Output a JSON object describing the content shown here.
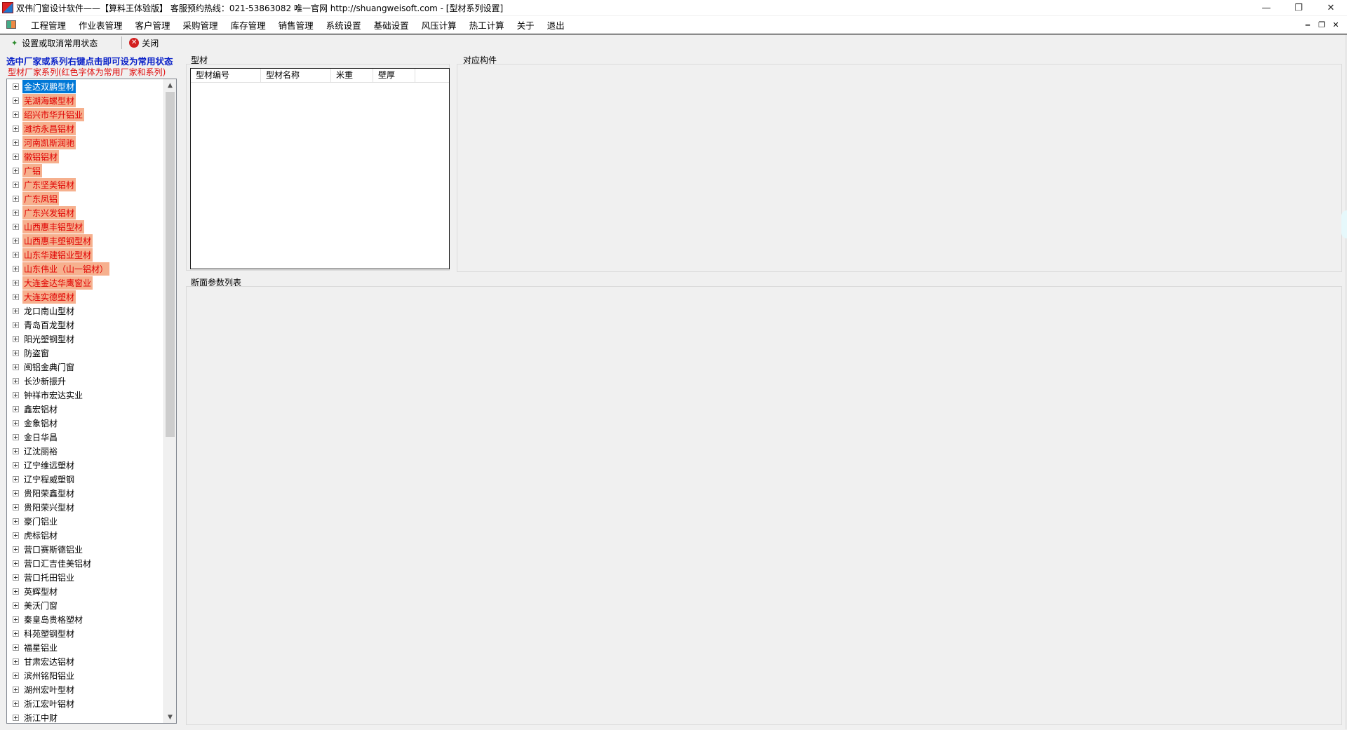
{
  "window": {
    "title": "双伟门窗设计软件——【算料王体验版】 客服预约热线：021-53863082  唯一官网 http://shuangweisoft.com  - [型材系列设置]",
    "controls": {
      "minimize": "—",
      "restore": "❐",
      "close": "✕"
    }
  },
  "menu": {
    "items": [
      "工程管理",
      "作业表管理",
      "客户管理",
      "采购管理",
      "库存管理",
      "销售管理",
      "系统设置",
      "基础设置",
      "风压计算",
      "热工计算",
      "关于",
      "退出"
    ],
    "mdi": {
      "minimize": "‒",
      "restore": "❐",
      "close": "✕"
    }
  },
  "toolbar": {
    "set_common": "设置或取消常用状态",
    "close": "关闭"
  },
  "left_panel": {
    "hint_primary": "选中厂家或系列右键点击即可设为常用状态",
    "hint_secondary": "型材厂家系列(红色字体为常用厂家和系列)",
    "tree": [
      {
        "label": "金达双鹏型材",
        "state": "selected"
      },
      {
        "label": "芜湖海螺型材",
        "state": "favorite"
      },
      {
        "label": "绍兴市华升铝业",
        "state": "favorite"
      },
      {
        "label": "潍坊永昌铝材",
        "state": "favorite"
      },
      {
        "label": "河南凯斯润驰",
        "state": "favorite"
      },
      {
        "label": "徽铝铝材",
        "state": "favorite"
      },
      {
        "label": "广铝",
        "state": "favorite"
      },
      {
        "label": "广东坚美铝材",
        "state": "favorite"
      },
      {
        "label": "广东凤铝",
        "state": "favorite"
      },
      {
        "label": "广东兴发铝材",
        "state": "favorite"
      },
      {
        "label": "山西惠丰铝型材",
        "state": "favorite"
      },
      {
        "label": "山西惠丰塑钢型材",
        "state": "favorite"
      },
      {
        "label": "山东华建铝业型材",
        "state": "favorite"
      },
      {
        "label": "山东伟业（山一铝材）",
        "state": "favorite"
      },
      {
        "label": "大连金达华鹰窗业",
        "state": "favorite"
      },
      {
        "label": "大连实德塑材",
        "state": "favorite"
      },
      {
        "label": "龙口南山型材",
        "state": "normal"
      },
      {
        "label": "青岛百龙型材",
        "state": "normal"
      },
      {
        "label": "阳光塑钢型材",
        "state": "normal"
      },
      {
        "label": "防盗窗",
        "state": "normal"
      },
      {
        "label": "闽铝金典门窗",
        "state": "normal"
      },
      {
        "label": "长沙新振升",
        "state": "normal"
      },
      {
        "label": "钟祥市宏达实业",
        "state": "normal"
      },
      {
        "label": "鑫宏铝材",
        "state": "normal"
      },
      {
        "label": "金象铝材",
        "state": "normal"
      },
      {
        "label": "金日华昌",
        "state": "normal"
      },
      {
        "label": "辽沈丽裕",
        "state": "normal"
      },
      {
        "label": "辽宁维远塑材",
        "state": "normal"
      },
      {
        "label": "辽宁程威塑钢",
        "state": "normal"
      },
      {
        "label": "贵阳荣鑫型材",
        "state": "normal"
      },
      {
        "label": "贵阳荣兴型材",
        "state": "normal"
      },
      {
        "label": "豪门铝业",
        "state": "normal"
      },
      {
        "label": "虎标铝材",
        "state": "normal"
      },
      {
        "label": "营口赛斯德铝业",
        "state": "normal"
      },
      {
        "label": "营口汇吉佳美铝材",
        "state": "normal"
      },
      {
        "label": "营口托田铝业",
        "state": "normal"
      },
      {
        "label": "英辉型材",
        "state": "normal"
      },
      {
        "label": "美沃门窗",
        "state": "normal"
      },
      {
        "label": "秦皇岛贵格塑材",
        "state": "normal"
      },
      {
        "label": "科苑塑钢型材",
        "state": "normal"
      },
      {
        "label": "福星铝业",
        "state": "normal"
      },
      {
        "label": "甘肃宏达铝材",
        "state": "normal"
      },
      {
        "label": "滨州铭阳铝业",
        "state": "normal"
      },
      {
        "label": "湖州宏叶型材",
        "state": "normal"
      },
      {
        "label": "浙江宏叶铝材",
        "state": "normal"
      },
      {
        "label": "浙江中财",
        "state": "normal"
      }
    ]
  },
  "profile_panel": {
    "title": "型材",
    "columns": [
      "型材编号",
      "型材名称",
      "米重",
      "壁厚"
    ]
  },
  "component_panel": {
    "title": "对应构件"
  },
  "section_panel": {
    "title": "断面参数列表"
  },
  "colors": {
    "favorite_bg": "#f6b08e",
    "favorite_text": "#e00000",
    "selected_bg": "#0078d7",
    "hint_blue": "#0b22c8"
  },
  "icons": [
    "app-icon",
    "menu-app-icon",
    "star-icon",
    "close-icon",
    "expand-icon",
    "scroll-up-icon",
    "scroll-down-icon"
  ]
}
